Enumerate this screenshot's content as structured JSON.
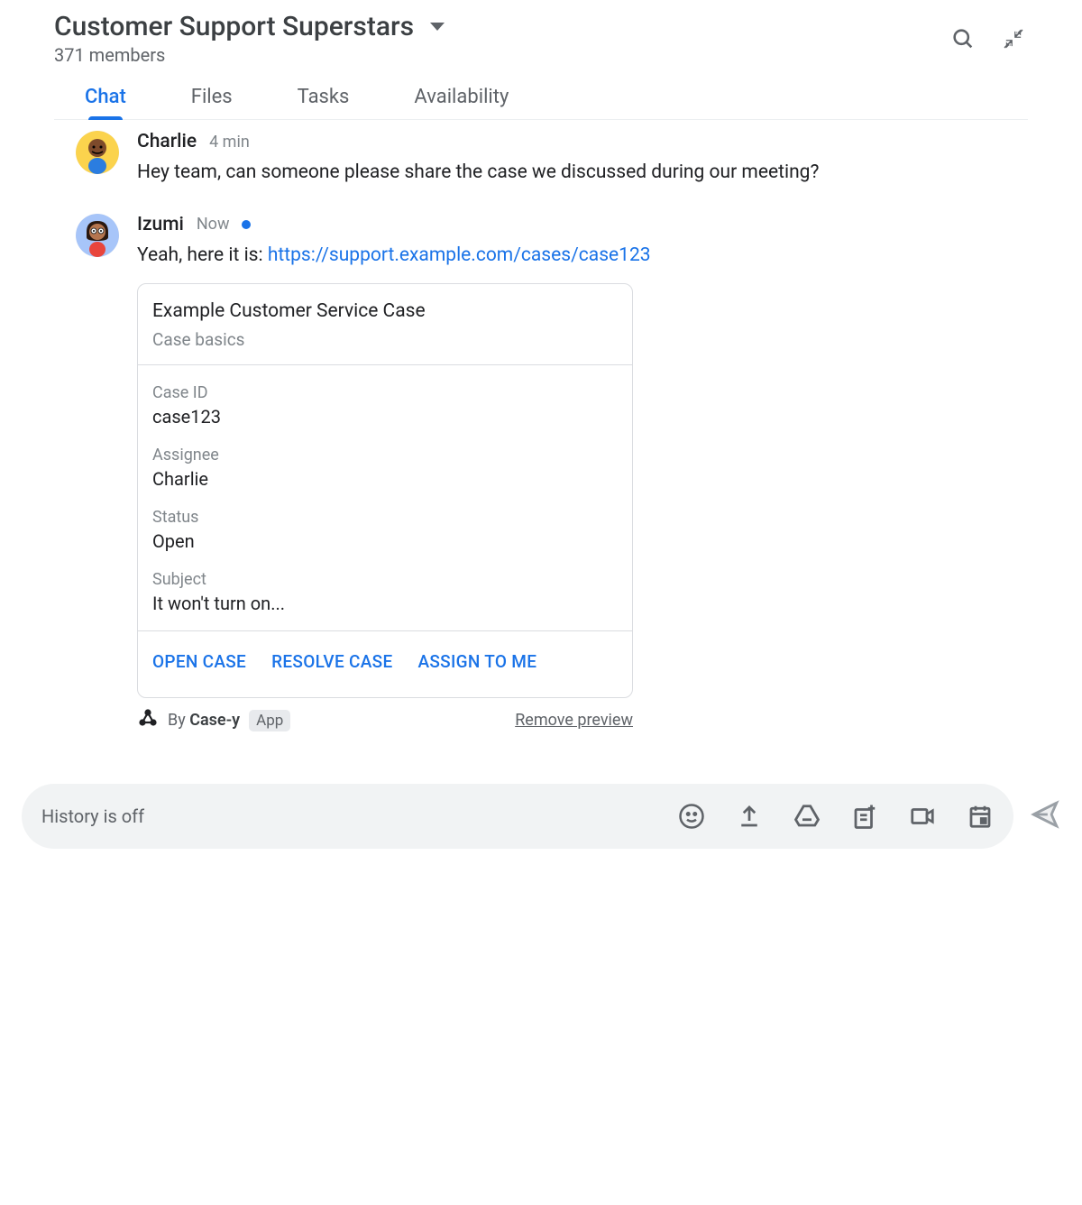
{
  "header": {
    "title": "Customer Support Superstars",
    "members": "371 members"
  },
  "tabs": [
    {
      "label": "Chat",
      "active": true
    },
    {
      "label": "Files",
      "active": false
    },
    {
      "label": "Tasks",
      "active": false
    },
    {
      "label": "Availability",
      "active": false
    }
  ],
  "messages": [
    {
      "author": "Charlie",
      "time": "4 min",
      "text": "Hey team, can someone please share the case we discussed during our meeting?"
    },
    {
      "author": "Izumi",
      "time": "Now",
      "hasStatusDot": true,
      "textPrefix": "Yeah, here it is: ",
      "link": "https://support.example.com/cases/case123"
    }
  ],
  "card": {
    "title": "Example Customer Service Case",
    "subtitle": "Case basics",
    "fields": [
      {
        "label": "Case ID",
        "value": "case123"
      },
      {
        "label": "Assignee",
        "value": "Charlie"
      },
      {
        "label": "Status",
        "value": "Open"
      },
      {
        "label": "Subject",
        "value": "It won't turn on..."
      }
    ],
    "actions": [
      "OPEN CASE",
      "RESOLVE CASE",
      "ASSIGN TO ME"
    ]
  },
  "attribution": {
    "byPrefix": "By ",
    "appName": "Case-y",
    "badge": "App",
    "removeLabel": "Remove preview"
  },
  "composer": {
    "placeholder": "History is off"
  }
}
